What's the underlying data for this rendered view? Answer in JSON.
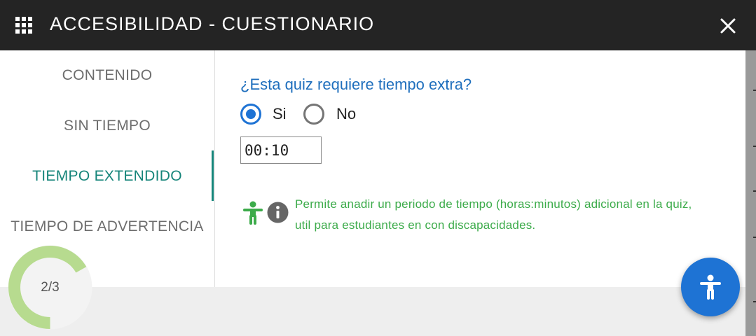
{
  "header": {
    "title": "ACCESIBILIDAD - CUESTIONARIO",
    "menu_icon": "grid-icon",
    "close_icon": "close-icon"
  },
  "sidebar": {
    "items": [
      {
        "label": "CONTENIDO"
      },
      {
        "label": "SIN TIEMPO"
      },
      {
        "label": "TIEMPO EXTENDIDO",
        "active": true
      },
      {
        "label": "TIEMPO DE ADVERTENCIA"
      }
    ]
  },
  "question": {
    "text": "¿Esta quiz requiere tiempo extra?",
    "options": [
      {
        "label": "Si",
        "selected": true
      },
      {
        "label": "No",
        "selected": false
      }
    ],
    "time_value": "00:10"
  },
  "help": {
    "text": "Permite anadir un periodo de tiempo (horas:minutos) adicional en la quiz, util para estudiantes en con discapacidades.",
    "icons": [
      "accessibility-icon",
      "info-icon"
    ]
  },
  "progress": {
    "label": "2/3",
    "fraction": 0.6667
  },
  "fab": {
    "icon": "accessibility-icon"
  },
  "colors": {
    "header_bg": "#242424",
    "accent_teal": "#16857a",
    "link_blue": "#1f6fbd",
    "radio_blue": "#1e73d4",
    "help_green": "#3cab4a",
    "progress_green": "#b7db8f",
    "fab_blue": "#1e73d4"
  }
}
